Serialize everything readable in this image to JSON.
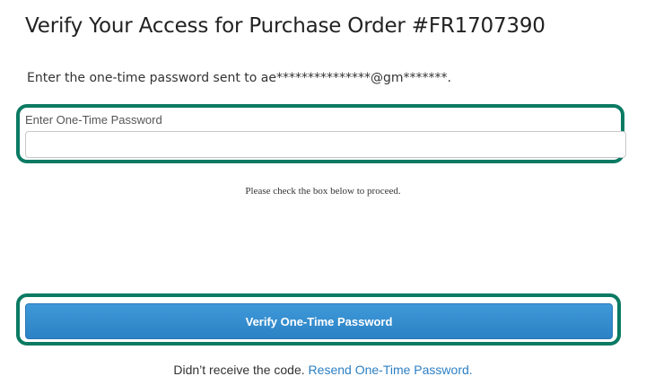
{
  "header": {
    "title": "Verify Your Access for Purchase Order #FR1707390"
  },
  "instruction": {
    "text": "Enter the one-time password sent to ae***************@gm*******."
  },
  "otp": {
    "label": "Enter One-Time Password",
    "value": "",
    "placeholder": ""
  },
  "captcha_note": "Please check the box below to proceed.",
  "verify_button": {
    "label": "Verify One-Time Password"
  },
  "resend": {
    "prompt": "Didn’t receive the code.",
    "link_label": "Resend One-Time Password."
  },
  "colors": {
    "highlight_border": "#0b7a63",
    "button_primary": "#2b82c4",
    "link": "#2c7fc4"
  }
}
